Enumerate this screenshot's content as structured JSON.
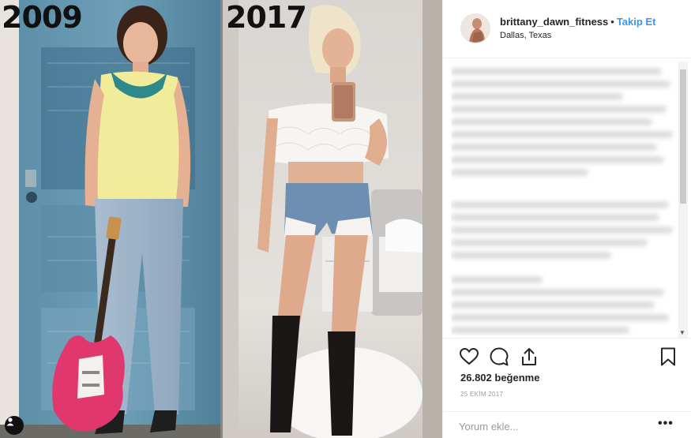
{
  "photo": {
    "left_year": "2009",
    "right_year": "2017",
    "tag_icon": "user-tag-icon"
  },
  "post": {
    "username": "brittany_dawn_fitness",
    "separator": "•",
    "follow_label": "Takip Et",
    "location": "Dallas, Texas",
    "likes_count": "26.802",
    "likes_label": "beğenme",
    "date": "25 EKİM 2017",
    "comment_placeholder": "Yorum ekle...",
    "more_label": "•••"
  },
  "icons": {
    "like": "heart-icon",
    "comment": "comment-bubble-icon",
    "share": "share-icon",
    "save": "bookmark-icon"
  },
  "colors": {
    "accent": "#3897f0",
    "text": "#262626",
    "muted": "#999999",
    "border": "#efefef"
  }
}
